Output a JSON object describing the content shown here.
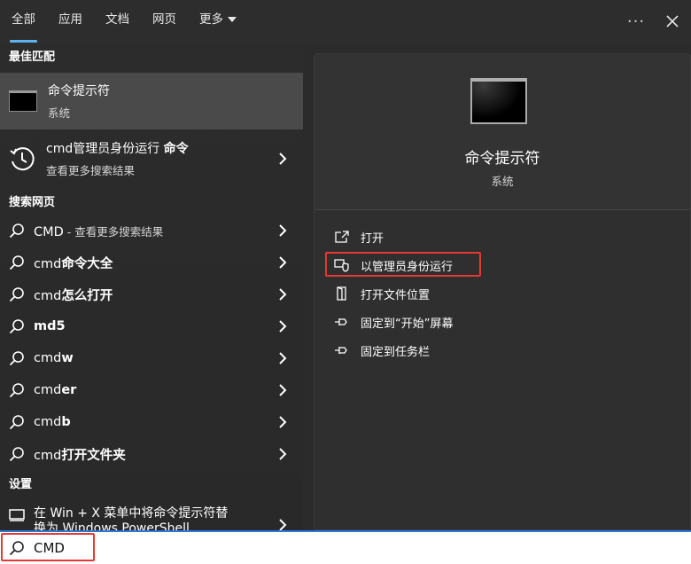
{
  "tabs": [
    {
      "label": "全部"
    },
    {
      "label": "应用"
    },
    {
      "label": "文档"
    },
    {
      "label": "网页"
    },
    {
      "label": "更多"
    }
  ],
  "topbar": {
    "more_label": "···"
  },
  "left": {
    "best_match_title": "最佳匹配",
    "best_match": {
      "title": "命令提示符",
      "subtitle": "系统"
    },
    "suggestion": {
      "title_plain": "cmd管理员身份运行 ",
      "title_bold": "命令",
      "subtitle": "查看更多搜索结果"
    },
    "web_title": "搜索网页",
    "web_items": [
      {
        "plain": "CMD",
        "bold": "",
        "sub": " - 查看更多搜索结果"
      },
      {
        "plain": "cmd",
        "bold": "命令大全",
        "sub": ""
      },
      {
        "plain": "cmd",
        "bold": "怎么打开",
        "sub": ""
      },
      {
        "plain": "",
        "bold": "md5",
        "sub": ""
      },
      {
        "plain": "cmd",
        "bold": "w",
        "sub": ""
      },
      {
        "plain": "cmd",
        "bold": "er",
        "sub": ""
      },
      {
        "plain": "cmd",
        "bold": "b",
        "sub": ""
      },
      {
        "plain": "cmd",
        "bold": "打开文件夹",
        "sub": ""
      }
    ],
    "settings_title": "设置",
    "settings_item": {
      "line1": "在 Win + X 菜单中将命令提示符替",
      "line2": "换为 Windows PowerShell"
    }
  },
  "right": {
    "app_title": "命令提示符",
    "app_subtitle": "系统",
    "actions": [
      {
        "label": "打开",
        "icon": "open-icon"
      },
      {
        "label": "以管理员身份运行",
        "icon": "shield-icon"
      },
      {
        "label": "打开文件位置",
        "icon": "folder-location-icon"
      },
      {
        "label": "固定到“开始”屏幕",
        "icon": "pin-icon"
      },
      {
        "label": "固定到任务栏",
        "icon": "pin-icon"
      }
    ]
  },
  "search": {
    "value": "CMD"
  },
  "colors": {
    "accent": "#5fb2f2",
    "highlight": "#e53935",
    "selected_bg": "#4a4a4a"
  }
}
